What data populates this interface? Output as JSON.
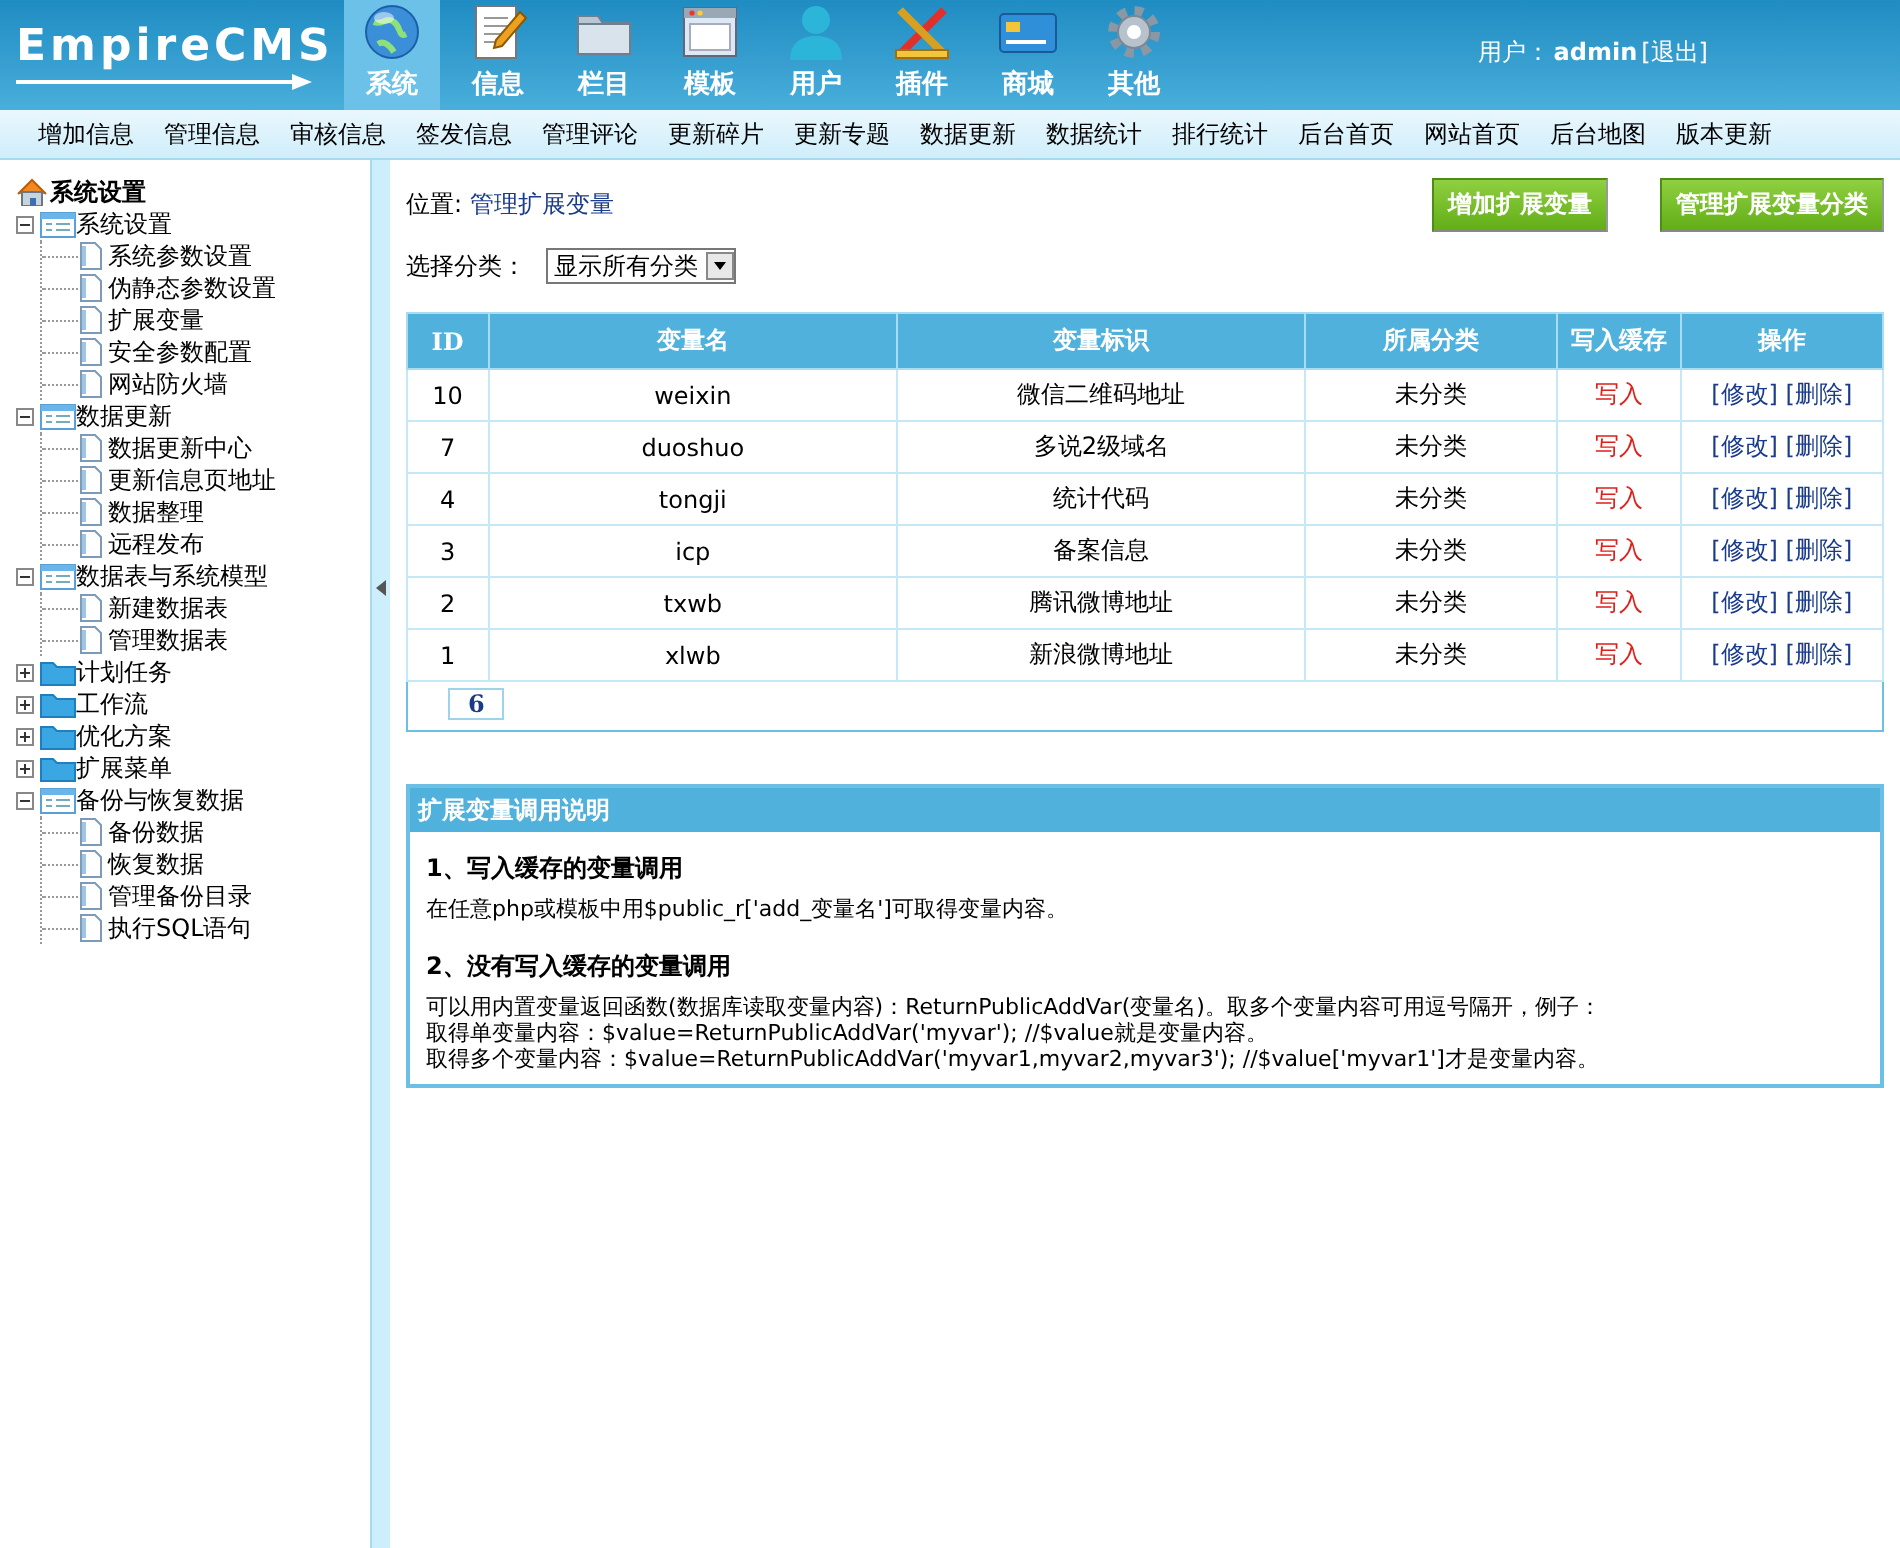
{
  "header": {
    "logo": "EmpireCMS",
    "nav": [
      {
        "label": "系统",
        "selected": true
      },
      {
        "label": "信息",
        "selected": false
      },
      {
        "label": "栏目",
        "selected": false
      },
      {
        "label": "模板",
        "selected": false
      },
      {
        "label": "用户",
        "selected": false
      },
      {
        "label": "插件",
        "selected": false
      },
      {
        "label": "商城",
        "selected": false
      },
      {
        "label": "其他",
        "selected": false
      }
    ],
    "user_label": "用户：",
    "user_name": "admin",
    "logout": "[退出]"
  },
  "submenu": [
    "增加信息",
    "管理信息",
    "审核信息",
    "签发信息",
    "管理评论",
    "更新碎片",
    "更新专题",
    "数据更新",
    "数据统计",
    "排行统计",
    "后台首页",
    "网站首页",
    "后台地图",
    "版本更新"
  ],
  "sidebar": {
    "title": "系统设置",
    "tree": [
      {
        "label": "系统设置",
        "expanded": true,
        "children": [
          "系统参数设置",
          "伪静态参数设置",
          "扩展变量",
          "安全参数配置",
          "网站防火墙"
        ]
      },
      {
        "label": "数据更新",
        "expanded": true,
        "children": [
          "数据更新中心",
          "更新信息页地址",
          "数据整理",
          "远程发布"
        ]
      },
      {
        "label": "数据表与系统模型",
        "expanded": true,
        "children": [
          "新建数据表",
          "管理数据表"
        ]
      },
      {
        "label": "计划任务",
        "expanded": false
      },
      {
        "label": "工作流",
        "expanded": false
      },
      {
        "label": "优化方案",
        "expanded": false
      },
      {
        "label": "扩展菜单",
        "expanded": false
      },
      {
        "label": "备份与恢复数据",
        "expanded": true,
        "children": [
          "备份数据",
          "恢复数据",
          "管理备份目录",
          "执行SQL语句"
        ]
      }
    ]
  },
  "main": {
    "location_label": "位置:",
    "location_link": "管理扩展变量",
    "buttons": [
      "增加扩展变量",
      "管理扩展变量分类"
    ],
    "filter_label": "选择分类：",
    "filter_value": "显示所有分类",
    "table": {
      "columns": [
        "ID",
        "变量名",
        "变量标识",
        "所属分类",
        "写入缓存",
        "操作"
      ],
      "rows": [
        {
          "id": "10",
          "name": "weixin",
          "mark": "微信二维码地址",
          "category": "未分类",
          "cache": "写入",
          "edit": "[修改]",
          "delete": "[删除]"
        },
        {
          "id": "7",
          "name": "duoshuo",
          "mark": "多说2级域名",
          "category": "未分类",
          "cache": "写入",
          "edit": "[修改]",
          "delete": "[删除]"
        },
        {
          "id": "4",
          "name": "tongji",
          "mark": "统计代码",
          "category": "未分类",
          "cache": "写入",
          "edit": "[修改]",
          "delete": "[删除]"
        },
        {
          "id": "3",
          "name": "icp",
          "mark": "备案信息",
          "category": "未分类",
          "cache": "写入",
          "edit": "[修改]",
          "delete": "[删除]"
        },
        {
          "id": "2",
          "name": "txwb",
          "mark": "腾讯微博地址",
          "category": "未分类",
          "cache": "写入",
          "edit": "[修改]",
          "delete": "[删除]"
        },
        {
          "id": "1",
          "name": "xlwb",
          "mark": "新浪微博地址",
          "category": "未分类",
          "cache": "写入",
          "edit": "[修改]",
          "delete": "[删除]"
        }
      ],
      "pager": "6"
    },
    "notes": {
      "title": "扩展变量调用说明",
      "sections": [
        {
          "heading": "1、写入缓存的变量调用",
          "lines": [
            "在任意php或模板中用$public_r['add_变量名']可取得变量内容。"
          ]
        },
        {
          "heading": "2、没有写入缓存的变量调用",
          "lines": [
            "可以用内置变量返回函数(数据库读取变量内容)：ReturnPublicAddVar(变量名)。取多个变量内容可用逗号隔开，例子：",
            "取得单变量内容：$value=ReturnPublicAddVar('myvar'); //$value就是变量内容。",
            "取得多个变量内容：$value=ReturnPublicAddVar('myvar1,myvar2,myvar3'); //$value['myvar1']才是变量内容。"
          ]
        }
      ]
    }
  }
}
